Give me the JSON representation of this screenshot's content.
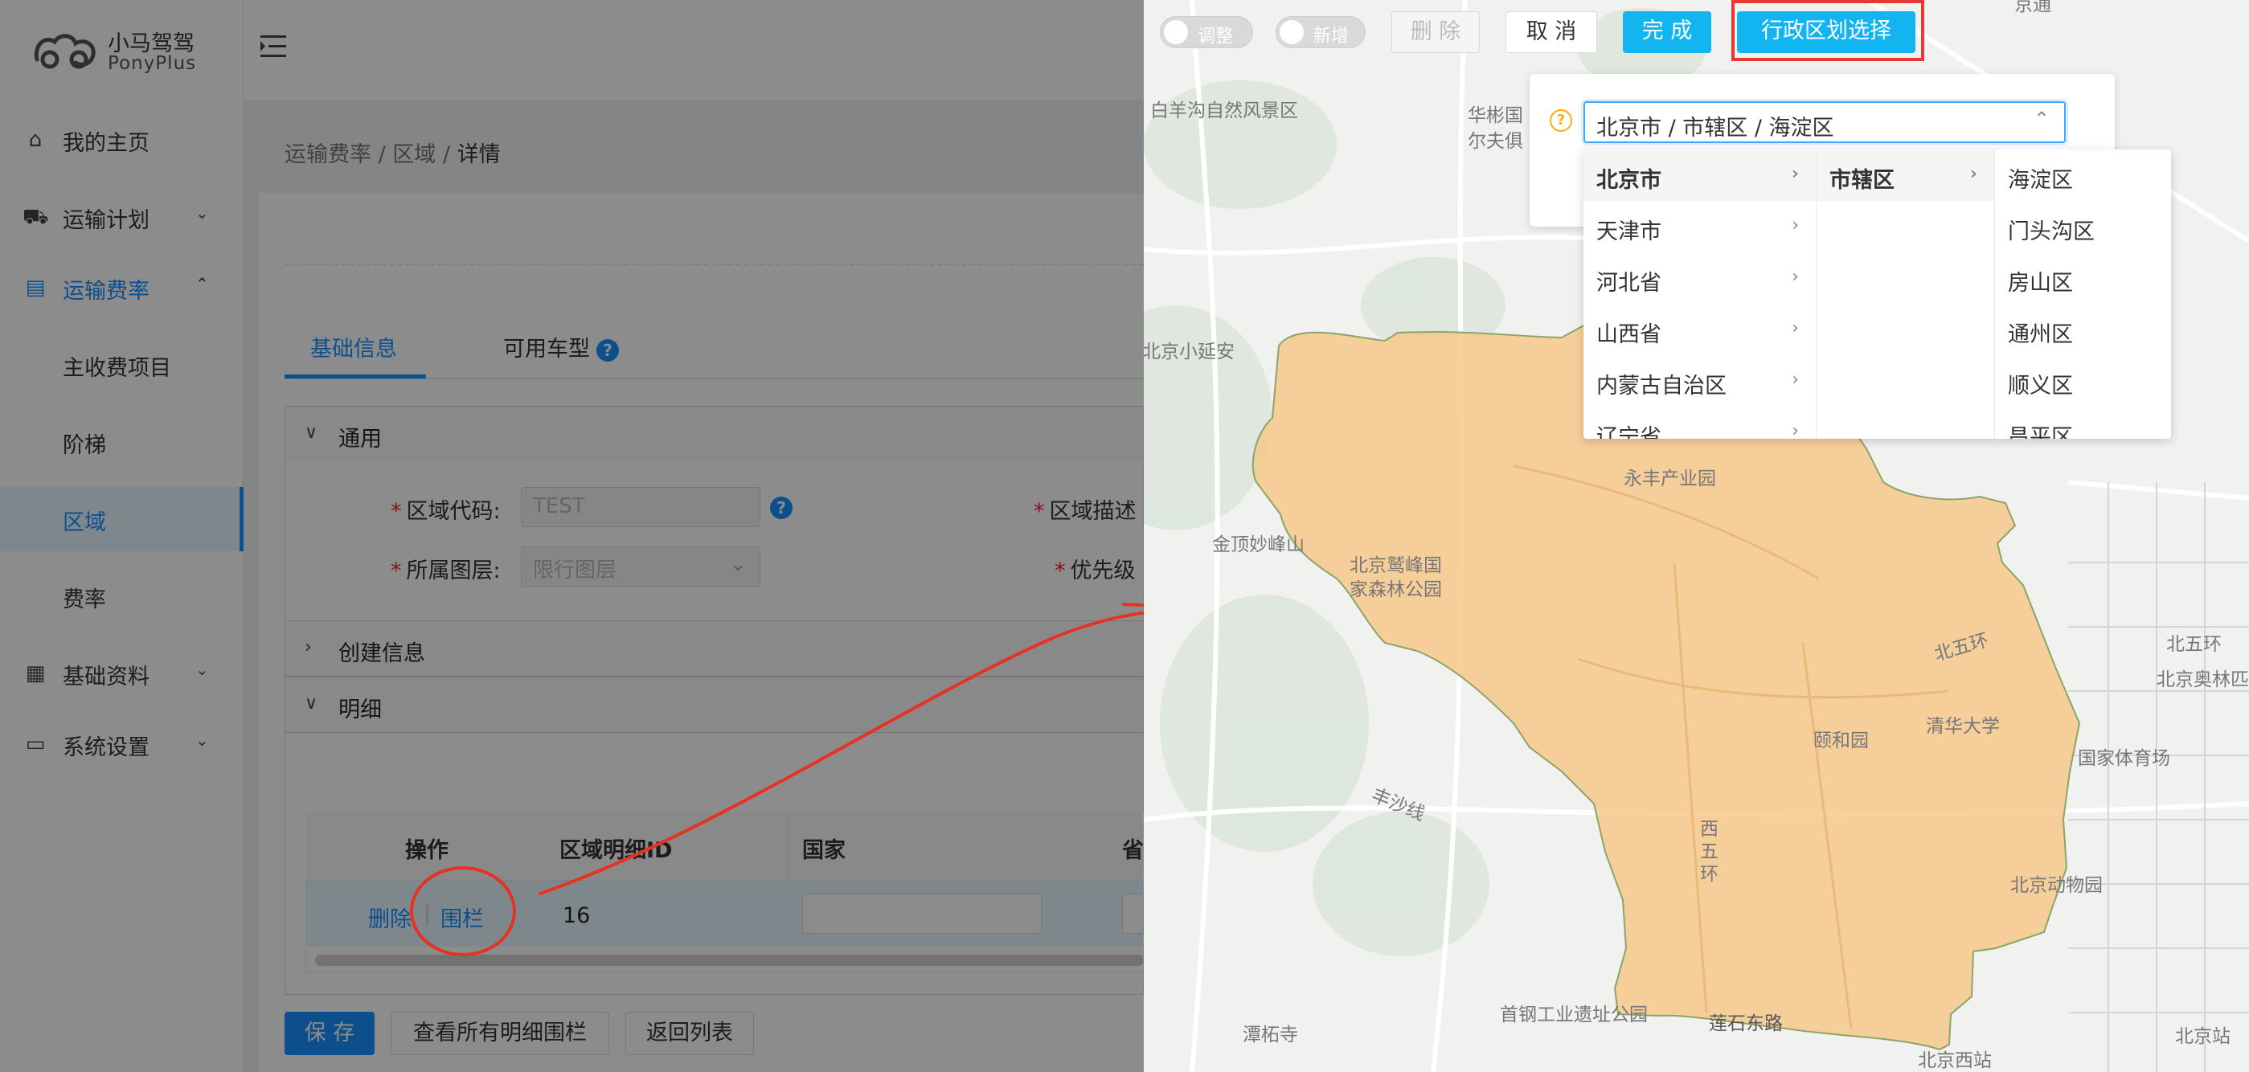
{
  "app": {
    "name_cn": "小马驾驾",
    "name_en": "PonyPlus"
  },
  "sidebar": {
    "items": [
      {
        "label": "我的主页",
        "icon": "home-icon"
      },
      {
        "label": "运输计划",
        "icon": "truck-icon"
      },
      {
        "label": "运输费率",
        "icon": "file-search-icon"
      },
      {
        "label": "主收费项目"
      },
      {
        "label": "阶梯"
      },
      {
        "label": "区域"
      },
      {
        "label": "费率"
      },
      {
        "label": "基础资料",
        "icon": "calendar-icon"
      },
      {
        "label": "系统设置",
        "icon": "desktop-icon"
      }
    ]
  },
  "breadcrumb": {
    "level1": "运输费率",
    "sep": "/",
    "level2": "区域",
    "level3": "详情"
  },
  "tabs": {
    "basic": "基础信息",
    "vehicle": "可用车型",
    "help": "?"
  },
  "panels": {
    "general": "通用",
    "create_info": "创建信息",
    "detail": "明细"
  },
  "form": {
    "region_code_label": "区域代码:",
    "region_code_value": "TEST",
    "region_desc_label": "区域描述",
    "layer_label": "所属图层:",
    "layer_placeholder": "限行图层",
    "priority_label": "优先级",
    "required_mark": "*"
  },
  "table": {
    "headers": {
      "action": "操作",
      "detail_id": "区域明细ID",
      "country": "国家",
      "province": "省"
    },
    "rows": [
      {
        "delete": "删除",
        "fence": "围栏",
        "id": "16"
      }
    ]
  },
  "buttons": {
    "save": "保 存",
    "view_all": "查看所有明细围栏",
    "back": "返回列表"
  },
  "map_toolbar": {
    "toggle_adjust": "调整",
    "toggle_add": "新增",
    "delete": "删 除",
    "cancel": "取 消",
    "done": "完 成",
    "admin_select": "行政区划选择"
  },
  "cascader": {
    "value": "北京市 / 市辖区 / 海淀区",
    "col1": [
      "北京市",
      "天津市",
      "河北省",
      "山西省",
      "内蒙古自治区",
      "辽宁省"
    ],
    "col2": [
      "市辖区"
    ],
    "col3": [
      "海淀区",
      "门头沟区",
      "房山区",
      "通州区",
      "顺义区",
      "昌平区"
    ]
  },
  "map_labels": {
    "l1": "白羊沟自然风景区",
    "l2": "华彬国",
    "l3": "尔夫俱",
    "l4": "北京小延安",
    "l5": "永丰产业园",
    "l6": "金顶妙峰山",
    "l7": "北京鹫峰国",
    "l8": "家森林公园",
    "l9": "北五环",
    "l10": "北五环",
    "l11": "北京奥林匹",
    "l12": "清华大学",
    "l13": "颐和园",
    "l14": "国家体育场",
    "l15": "丰沙线",
    "l16": "西",
    "l17": "五",
    "l18": "环",
    "l19": "北京动物园",
    "l20": "首钢工业遗址公园",
    "l21": "莲石东路",
    "l22": "潭柘寺",
    "l23": "北京西站",
    "l24": "北京站",
    "l25": "京通"
  },
  "colors": {
    "primary": "#1890ff",
    "map_button": "#13b5f0",
    "highlight_red": "#e53935",
    "region_fill": "#f7c88a"
  }
}
